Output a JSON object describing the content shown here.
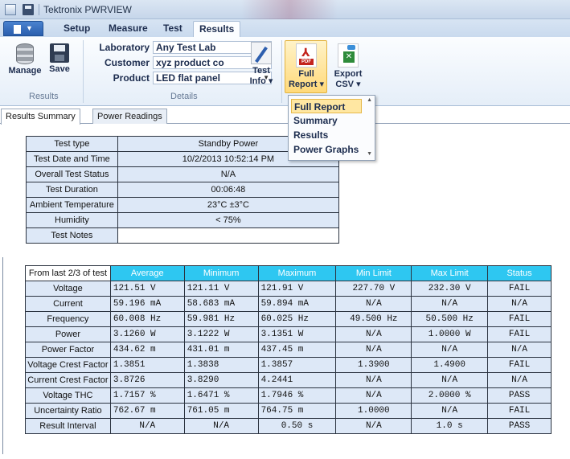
{
  "window": {
    "title": "Tektronix PWRVIEW"
  },
  "tabs": [
    {
      "label": "Setup"
    },
    {
      "label": "Measure"
    },
    {
      "label": "Test"
    },
    {
      "label": "Results",
      "active": true
    }
  ],
  "ribbon": {
    "results_group": {
      "label": "Results",
      "manage_label": "Manage",
      "save_label": "Save"
    },
    "details_group": {
      "label": "Details",
      "laboratory_label": "Laboratory",
      "laboratory_value": "Any Test Lab",
      "customer_label": "Customer",
      "customer_value": "xyz product co",
      "product_label": "Product",
      "product_value": "LED flat panel",
      "test_info_line1": "Test",
      "test_info_line2": "Info ▾"
    },
    "export_group": {
      "full_report_line1": "Full",
      "full_report_line2": "Report ▾",
      "pdf_badge": "PDF",
      "export_csv_line1": "Export",
      "export_csv_line2": "CSV ▾"
    }
  },
  "report_menu": {
    "items": [
      {
        "label": "Full Report",
        "selected": true
      },
      {
        "label": "Summary"
      },
      {
        "label": "Results"
      },
      {
        "label": "Power Graphs"
      }
    ]
  },
  "content_tabs": [
    {
      "label": "Results Summary",
      "active": true
    },
    {
      "label": "Power Readings"
    }
  ],
  "test_info": [
    {
      "key": "Test type",
      "value": "Standby Power"
    },
    {
      "key": "Test Date and Time",
      "value": "10/2/2013 10:52:14 PM"
    },
    {
      "key": "Overall Test Status",
      "value": "N/A"
    },
    {
      "key": "Test Duration",
      "value": "00:06:48"
    },
    {
      "key": "Ambient Temperature",
      "value": "23°C ±3°C"
    },
    {
      "key": "Humidity",
      "value": "< 75%"
    },
    {
      "key": "Test Notes",
      "value": ""
    }
  ],
  "results_table": {
    "headers": [
      "From last 2/3 of test",
      "Average",
      "Minimum",
      "Maximum",
      "Min Limit",
      "Max Limit",
      "Status"
    ],
    "rows": [
      {
        "label": "Voltage",
        "average": "121.51 V",
        "minimum": "121.11 V",
        "maximum": "121.91 V",
        "min_limit": "227.70 V",
        "max_limit": "232.30 V",
        "status": "FAIL"
      },
      {
        "label": "Current",
        "average": "59.196 mA",
        "minimum": "58.683 mA",
        "maximum": "59.894 mA",
        "min_limit": "N/A",
        "max_limit": "N/A",
        "status": "N/A"
      },
      {
        "label": "Frequency",
        "average": "60.008 Hz",
        "minimum": "59.981 Hz",
        "maximum": "60.025 Hz",
        "min_limit": "49.500 Hz",
        "max_limit": "50.500 Hz",
        "status": "FAIL"
      },
      {
        "label": "Power",
        "average": "3.1260 W",
        "minimum": "3.1222 W",
        "maximum": "3.1351 W",
        "min_limit": "N/A",
        "max_limit": "1.0000 W",
        "status": "FAIL"
      },
      {
        "label": "Power Factor",
        "average": "434.62 m",
        "minimum": "431.01 m",
        "maximum": "437.45 m",
        "min_limit": "N/A",
        "max_limit": "N/A",
        "status": "N/A"
      },
      {
        "label": "Voltage Crest Factor",
        "average": "1.3851",
        "minimum": "1.3838",
        "maximum": "1.3857",
        "min_limit": "1.3900",
        "max_limit": "1.4900",
        "status": "FAIL"
      },
      {
        "label": "Current Crest Factor",
        "average": "3.8726",
        "minimum": "3.8290",
        "maximum": "4.2441",
        "min_limit": "N/A",
        "max_limit": "N/A",
        "status": "N/A"
      },
      {
        "label": "Voltage THC",
        "average": "1.7157 %",
        "minimum": "1.6471 %",
        "maximum": "1.7946 %",
        "min_limit": "N/A",
        "max_limit": "2.0000 %",
        "status": "PASS"
      },
      {
        "label": "Uncertainty Ratio",
        "average": "762.67 m",
        "minimum": "761.05 m",
        "maximum": "764.75 m",
        "min_limit": "1.0000",
        "max_limit": "N/A",
        "status": "FAIL"
      },
      {
        "label": "Result Interval",
        "average": "N/A",
        "minimum": "N/A",
        "maximum": "0.50 s",
        "min_limit": "N/A",
        "max_limit": "1.0 s",
        "status": "PASS"
      }
    ]
  },
  "colors": {
    "header_cyan": "#2ec7f1",
    "cell_blue": "#dde8f7",
    "menu_highlight": "#ffe7a2"
  }
}
